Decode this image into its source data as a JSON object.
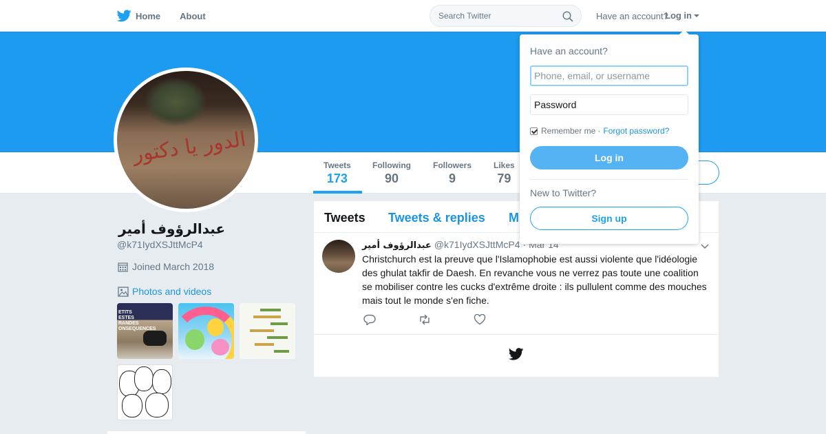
{
  "topnav": {
    "home_label": "Home",
    "about_label": "About",
    "search_placeholder": "Search Twitter",
    "have_account": "Have an account?",
    "login_label": "Log in"
  },
  "profile": {
    "name": "عبدالرؤوف أمير",
    "handle": "@k71IydXSJttMcP4",
    "joined": "Joined March 2018",
    "photos_label": "Photos and videos",
    "avatar_graffiti": "أجاك الدور يا دكتور"
  },
  "stats": [
    {
      "label": "Tweets",
      "value": "173"
    },
    {
      "label": "Following",
      "value": "90"
    },
    {
      "label": "Followers",
      "value": "9"
    },
    {
      "label": "Likes",
      "value": "79"
    }
  ],
  "timeline": {
    "tabs": [
      "Tweets",
      "Tweets & replies",
      "M"
    ],
    "tweet": {
      "author": "عبدالرؤوف أمير",
      "handle": "@k71IydXSJttMcP4",
      "date": "· Mar 14",
      "text": "Christchurch est la preuve que l'Islamophobie est aussi violente que l'idéologie des ghulat takfir de Daesh. En revanche vous ne verrez pas toute une coalition se mobiliser contre les cucks d'extrême droite : ils pullulent comme des mouches mais tout le monde s'en fiche."
    }
  },
  "thumbnails": {
    "t1_text": "ETITS\nESTES\nRANDES\nONSEQUENCES"
  },
  "login_dropdown": {
    "title": "Have an account?",
    "username_placeholder": "Phone, email, or username",
    "password_placeholder": "Password",
    "remember_label": "Remember me",
    "separator": "·",
    "forgot_label": "Forgot password?",
    "login_button": "Log in",
    "new_label": "New to Twitter?",
    "signup_button": "Sign up"
  },
  "colors": {
    "brand_blue": "#1da1f2",
    "banner_blue": "#1d9bf0",
    "background": "#e6ecf0"
  }
}
